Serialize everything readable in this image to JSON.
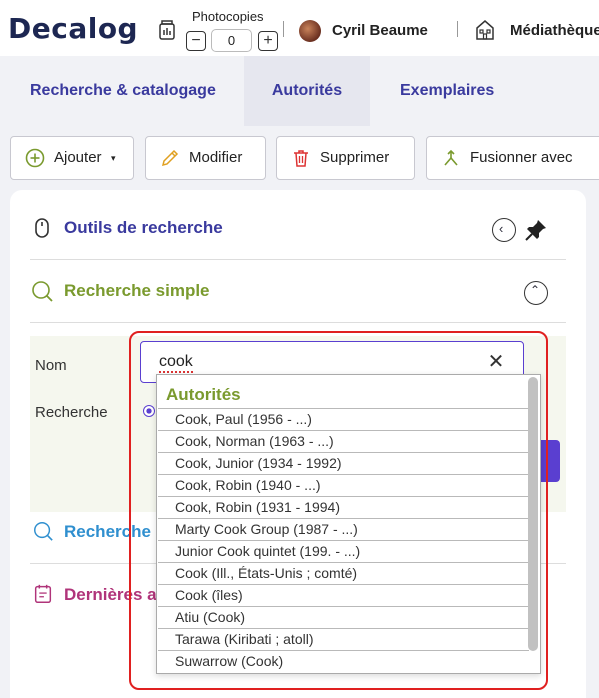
{
  "header": {
    "logo": "Decalog",
    "photocopies_label": "Photocopies",
    "photocopies_value": "0",
    "minus": "−",
    "plus": "+",
    "user": "Cyril Beaume",
    "library": "Médiathèque"
  },
  "tabs": [
    "Recherche & catalogage",
    "Autorités",
    "Exemplaires"
  ],
  "toolbar": {
    "add": "Ajouter",
    "modify": "Modifier",
    "delete": "Supprimer",
    "merge": "Fusionner avec"
  },
  "panel": {
    "tools_title": "Outils de recherche",
    "simple_title": "Recherche simple",
    "advanced_title": "Recherche",
    "recent_title": "Dernières a",
    "field_name": "Nom",
    "field_search": "Recherche",
    "search_value": "cook",
    "clear": "✕"
  },
  "dropdown": {
    "heading": "Autorités",
    "items": [
      "Cook, Paul (1956 - ...)",
      "Cook, Norman (1963 - ...)",
      "Cook, Junior (1934 - 1992)",
      "Cook, Robin (1940 - ...)",
      "Cook, Robin (1931 - 1994)",
      "Marty Cook Group (1987 - ...)",
      "Junior Cook quintet (199. - ...)",
      "Cook (Ill., États-Unis ; comté)",
      "Cook (îles)",
      "Atiu (Cook)",
      "Tarawa (Kiribati ; atoll)",
      "Suwarrow (Cook)"
    ]
  },
  "colors": {
    "primary": "#3a3a9e",
    "tools_title": "#3a3a9e",
    "simple_title": "#7a9a2e",
    "advanced_title": "#2f8fcf",
    "recent_title": "#b0347a",
    "highlight": "#e02020"
  }
}
